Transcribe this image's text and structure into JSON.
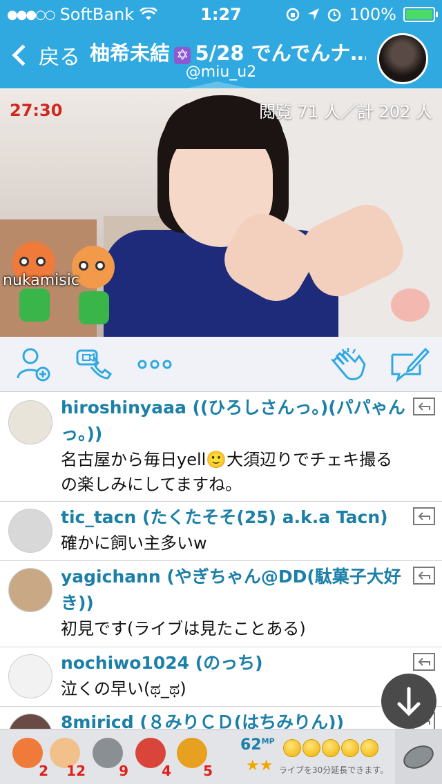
{
  "status_bar": {
    "carrier": "SoftBank",
    "time": "1:27",
    "battery": "100%",
    "battery_level": 1.0
  },
  "header": {
    "back_label": "戻る",
    "title": "柚希未結 ✡️ 5/28 でんでんナ…",
    "title_name": "柚希未結",
    "title_badge": "✡",
    "title_rest": "5/28 でんでんナ…",
    "handle": "@miu_u2"
  },
  "video": {
    "timer": "27:30",
    "viewers": "閲覧 71 人／計 202 人",
    "watermark": "nukamisic"
  },
  "actions": {
    "add_user": "add-user-icon",
    "video_call": "video-call-icon",
    "more": "more-icon",
    "clap": "clap-icon",
    "compose": "compose-icon"
  },
  "comments": [
    {
      "name": "hiroshinyaaa ((ひろしさんっ。)(パパゃんっ。))",
      "text": "名古屋から毎日yell🙂大須辺りでチェキ撮るの楽しみにしてますね。"
    },
    {
      "name": "tic_tacn (たくたそそ(25) a.k.a Tacn)",
      "text": "確かに飼い主多いw"
    },
    {
      "name": "yagichann (やぎちゃん@DD(駄菓子大好き))",
      "text": "初見です(ライブは見たことある)"
    },
    {
      "name": "nochiwo1024 (のっち)",
      "text": "泣くの早い(ಥ_ಥ)"
    },
    {
      "name": "8miricd (８みりＣＤ(はちみりん))",
      "text": ""
    }
  ],
  "gifts": [
    {
      "icon": "mascot-gift-icon",
      "count": "2",
      "color": "#f07a3a"
    },
    {
      "icon": "clap-gift-icon",
      "count": "12",
      "color": "#f2c08a"
    },
    {
      "icon": "coin-gift-icon",
      "count": "9",
      "color": "#8a8f94"
    },
    {
      "icon": "cake-gift-icon",
      "count": "4",
      "color": "#d9453a"
    },
    {
      "icon": "party-popper-gift-icon",
      "count": "5",
      "color": "#e8a020"
    }
  ],
  "bottom": {
    "mp_value": "62",
    "mp_unit": "MP",
    "stars": "★★",
    "extend_text": "ライブを30分延長できます。"
  }
}
